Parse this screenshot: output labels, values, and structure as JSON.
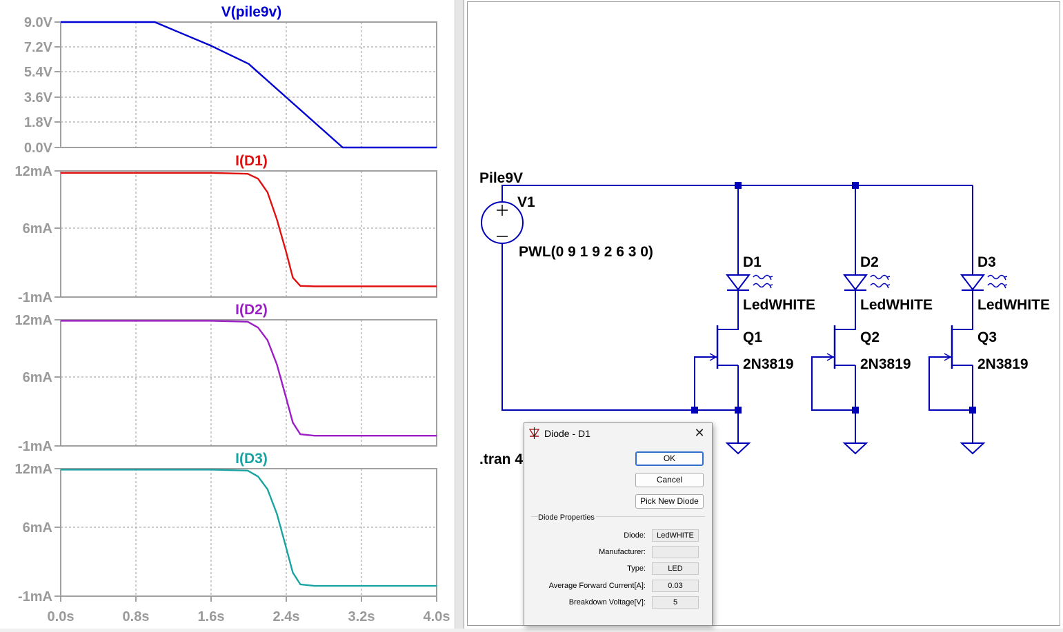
{
  "plots": [
    {
      "title": "V(pile9v)",
      "color": "#0000d0",
      "y_ticks": [
        "9.0V",
        "7.2V",
        "5.4V",
        "3.6V",
        "1.8V",
        "0.0V"
      ],
      "y_range": [
        0,
        9
      ],
      "points": [
        [
          0,
          9
        ],
        [
          1.0,
          9
        ],
        [
          1.6,
          7.3
        ],
        [
          2.0,
          6.0
        ],
        [
          3.0,
          0
        ],
        [
          4.0,
          0
        ]
      ]
    },
    {
      "title": "I(D1)",
      "color": "#e01010",
      "y_ticks": [
        "12mA",
        "6mA",
        "-1mA"
      ],
      "y_range": [
        -1,
        12
      ],
      "points": [
        [
          0,
          11.8
        ],
        [
          1.6,
          11.8
        ],
        [
          1.99,
          11.7
        ],
        [
          2.1,
          11.2
        ],
        [
          2.2,
          9.8
        ],
        [
          2.3,
          7.0
        ],
        [
          2.4,
          3.6
        ],
        [
          2.47,
          1.0
        ],
        [
          2.55,
          0.15
        ],
        [
          2.7,
          0.1
        ],
        [
          4.0,
          0.1
        ]
      ]
    },
    {
      "title": "I(D2)",
      "color": "#9b1fc4",
      "y_ticks": [
        "12mA",
        "6mA",
        "-1mA"
      ],
      "y_range": [
        -1,
        12
      ],
      "points": [
        [
          0,
          11.9
        ],
        [
          1.6,
          11.9
        ],
        [
          1.99,
          11.8
        ],
        [
          2.1,
          11.2
        ],
        [
          2.2,
          9.9
        ],
        [
          2.3,
          7.4
        ],
        [
          2.4,
          3.9
        ],
        [
          2.47,
          1.4
        ],
        [
          2.55,
          0.2
        ],
        [
          2.7,
          0.05
        ],
        [
          4.0,
          0.05
        ]
      ]
    },
    {
      "title": "I(D3)",
      "color": "#1aa3a3",
      "y_ticks": [
        "12mA",
        "6mA",
        "-1mA"
      ],
      "y_range": [
        -1,
        12
      ],
      "points": [
        [
          0,
          11.9
        ],
        [
          1.6,
          11.9
        ],
        [
          1.99,
          11.8
        ],
        [
          2.1,
          11.2
        ],
        [
          2.2,
          9.9
        ],
        [
          2.3,
          7.4
        ],
        [
          2.4,
          3.9
        ],
        [
          2.47,
          1.4
        ],
        [
          2.55,
          0.2
        ],
        [
          2.7,
          0.05
        ],
        [
          4.0,
          0.05
        ]
      ]
    }
  ],
  "x_axis": {
    "range": [
      0,
      4
    ],
    "ticks": [
      "0.0s",
      "0.8s",
      "1.6s",
      "2.4s",
      "3.2s",
      "4.0s"
    ]
  },
  "schematic": {
    "wire_color": "#0000b8",
    "net_label": "Pile9V",
    "source_name": "V1",
    "source_value": "PWL(0 9 1 9 2 6 3 0)",
    "directive_text": ".tran 4",
    "branches": [
      {
        "diode": "D1",
        "diode_model": "LedWHITE",
        "jfet": "Q1",
        "jfet_model": "2N3819"
      },
      {
        "diode": "D2",
        "diode_model": "LedWHITE",
        "jfet": "Q2",
        "jfet_model": "2N3819"
      },
      {
        "diode": "D3",
        "diode_model": "LedWHITE",
        "jfet": "Q3",
        "jfet_model": "2N3819"
      }
    ]
  },
  "dialog": {
    "title": "Diode - D1",
    "buttons": {
      "ok": "OK",
      "cancel": "Cancel",
      "pick": "Pick New Diode"
    },
    "group_title": "Diode Properties",
    "properties": [
      {
        "label": "Diode:",
        "value": "LedWHITE"
      },
      {
        "label": "Manufacturer:",
        "value": ""
      },
      {
        "label": "Type:",
        "value": "LED"
      },
      {
        "label": "Average Forward Current[A]:",
        "value": "0.03"
      },
      {
        "label": "Breakdown Voltage[V]:",
        "value": "5"
      }
    ]
  }
}
